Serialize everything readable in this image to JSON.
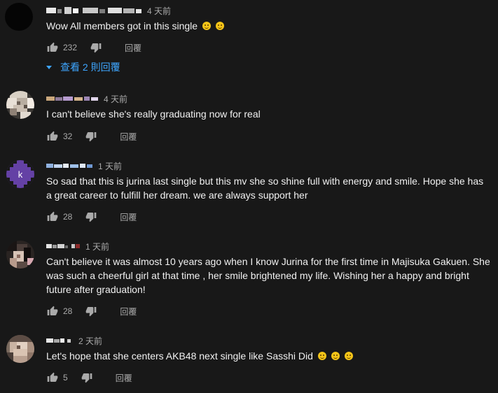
{
  "comments": [
    {
      "time": "4 天前",
      "text": "Wow All members got in this single",
      "emojis": [
        "grinning-emoji",
        "smiling-emoji"
      ],
      "likes": "232",
      "reply_label": "回覆",
      "view_replies": "查看 2 則回覆"
    },
    {
      "time": "4 天前",
      "text": "I can't believe she's really graduating now for real",
      "likes": "32",
      "reply_label": "回覆"
    },
    {
      "time": "1 天前",
      "text": "So sad that this is jurina last single but this mv she so shine full with energy and smile. Hope she has a great career to fulfill her dream. we are always support her",
      "avatar_letter": "k",
      "likes": "28",
      "reply_label": "回覆"
    },
    {
      "time": "1 天前",
      "text": "Can't believe it was almost 10 years ago when I know Jurina for the first time in Majisuka Gakuen. She was such a cheerful girl at that time , her smile brightened my life. Wishing her a happy and bright future after graduation!",
      "likes": "28",
      "reply_label": "回覆"
    },
    {
      "time": "2 天前",
      "text": "Let's hope that she centers AKB48 next single like Sasshi Did",
      "emojis": [
        "winking-emoji",
        "winking-emoji",
        "winking-emoji"
      ],
      "likes": "5",
      "reply_label": "回覆"
    }
  ],
  "colors": {
    "background": "#181818",
    "text": "#f1f1f1",
    "secondary_text": "#aaaaaa",
    "link": "#3ea6ff",
    "purple_avatar": "#6441a5"
  }
}
